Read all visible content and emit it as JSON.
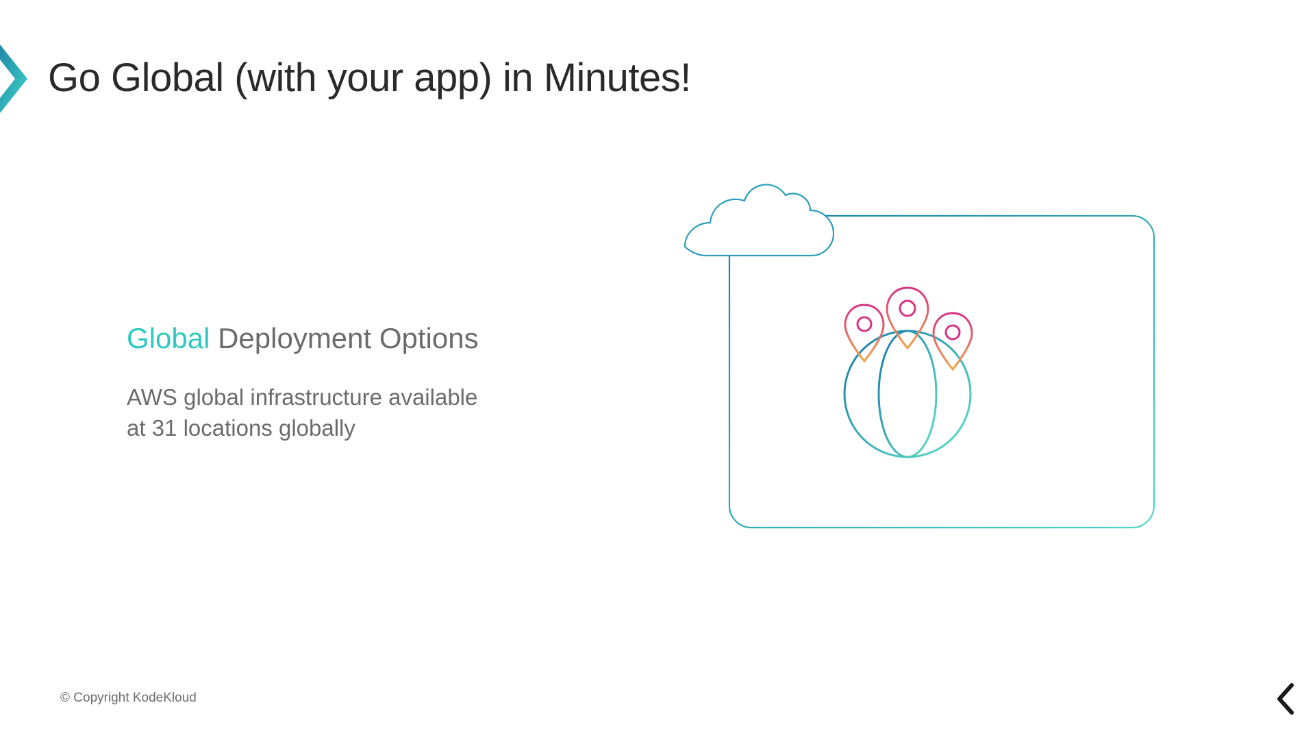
{
  "slide": {
    "title": "Go Global (with your app) in Minutes!",
    "subtitle_accent": "Global",
    "subtitle_rest": " Deployment Options",
    "description_line1": "AWS global infrastructure available",
    "description_line2": "at 31 locations globally",
    "copyright": "© Copyright KodeKloud"
  }
}
